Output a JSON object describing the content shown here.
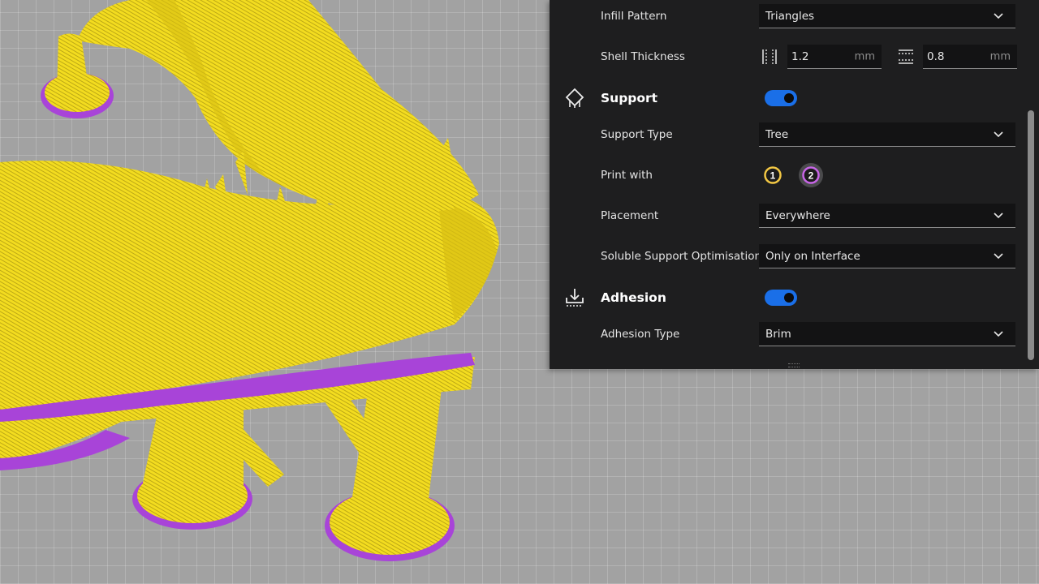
{
  "settings": {
    "infill_pattern": {
      "label": "Infill Pattern",
      "value": "Triangles"
    },
    "shell_thickness": {
      "label": "Shell Thickness",
      "wall": {
        "value": "1.2",
        "unit": "mm"
      },
      "top_bottom": {
        "value": "0.8",
        "unit": "mm"
      }
    },
    "support": {
      "title": "Support",
      "enabled": true,
      "support_type": {
        "label": "Support Type",
        "value": "Tree"
      },
      "print_with": {
        "label": "Print with",
        "extruders": [
          "1",
          "2"
        ]
      },
      "placement": {
        "label": "Placement",
        "value": "Everywhere"
      },
      "soluble": {
        "label": "Soluble Support Optimisation",
        "value": "Only on Interface"
      }
    },
    "adhesion": {
      "title": "Adhesion",
      "enabled": true,
      "adhesion_type": {
        "label": "Adhesion Type",
        "value": "Brim"
      }
    }
  },
  "colors": {
    "panel_bg": "#1e1e1f",
    "toggle_on": "#1a6fe8",
    "extruder_1": "#f2c744",
    "extruder_2": "#c765e6",
    "model_fill": "#f3dc1f",
    "brim": "#a844d8"
  },
  "icons": {
    "support": "support-icon",
    "adhesion": "adhesion-icon",
    "wall_thickness": "wall-thickness-icon",
    "top_bottom_thickness": "top-bottom-thickness-icon",
    "dropdown": "chevron-down-icon"
  }
}
